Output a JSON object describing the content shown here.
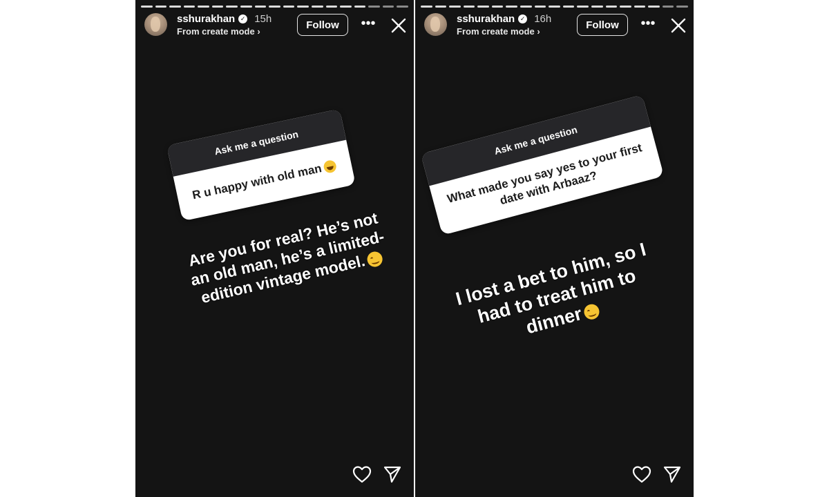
{
  "stories": [
    {
      "username": "sshurakhan",
      "time": "15h",
      "subtitle": "From create mode ›",
      "follow_label": "Follow",
      "more_label": "•••",
      "question_title": "Ask me a question",
      "question_text": "R u happy with old man",
      "answer_text": "Are you for real? He’s not an old man, he’s a limited-edition vintage model."
    },
    {
      "username": "sshurakhan",
      "time": "16h",
      "subtitle": "From create mode ›",
      "follow_label": "Follow",
      "more_label": "•••",
      "question_title": "Ask me a question",
      "question_text": "What made you say yes to your first date with Arbaaz?",
      "answer_text": "I lost a bet to him, so I had to treat him to dinner"
    }
  ],
  "colors": {
    "story_background": "#141414",
    "question_header": "#262629",
    "question_body": "#ffffff",
    "text": "#ffffff"
  },
  "icons": [
    "verified-badge-icon",
    "more-icon",
    "close-icon",
    "laughing-emoji-icon",
    "smiling-emoji-icon",
    "heart-icon",
    "send-icon"
  ]
}
